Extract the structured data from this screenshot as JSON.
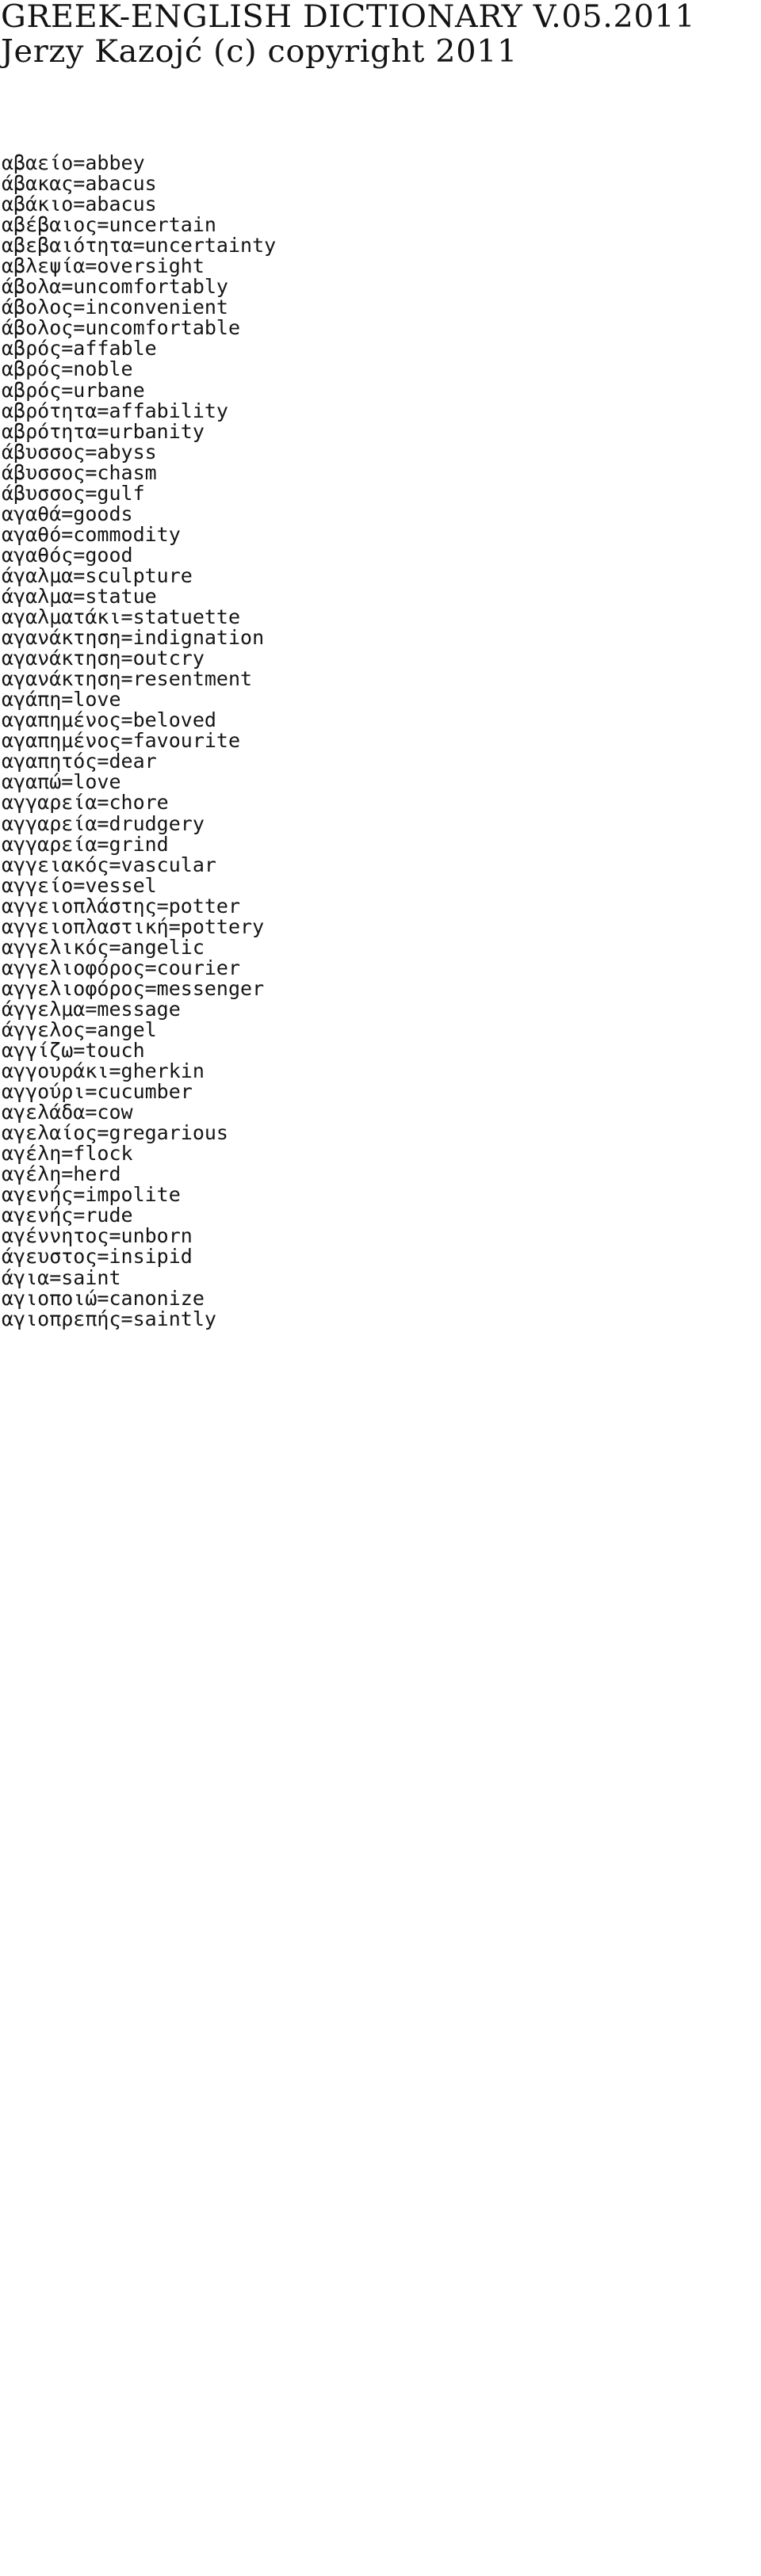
{
  "document": {
    "kind": "text-document",
    "background_color": "#ffffff",
    "text_color": "#151515",
    "header": {
      "title": "GREEK-ENGLISH DICTIONARY V.05.2011",
      "byline": "Jerzy Kazojć (c) copyright 2011"
    },
    "separator": "=",
    "entries": [
      {
        "greek": "αβαείο",
        "english": "abbey",
        "line": "αβαείο=abbey"
      },
      {
        "greek": "άβακας",
        "english": "abacus",
        "line": "άβακας=abacus"
      },
      {
        "greek": "αβάκιο",
        "english": "abacus",
        "line": "αβάκιο=abacus"
      },
      {
        "greek": "αβέβαιος",
        "english": "uncertain",
        "line": "αβέβαιος=uncertain"
      },
      {
        "greek": "αβεβαιότητα",
        "english": "uncertainty",
        "line": "αβεβαιότητα=uncertainty"
      },
      {
        "greek": "αβλεψία",
        "english": "oversight",
        "line": "αβλεψία=oversight"
      },
      {
        "greek": "άβολα",
        "english": "uncomfortably",
        "line": "άβολα=uncomfortably"
      },
      {
        "greek": "άβολος",
        "english": "inconvenient",
        "line": "άβολος=inconvenient"
      },
      {
        "greek": "άβολος",
        "english": "uncomfortable",
        "line": "άβολος=uncomfortable"
      },
      {
        "greek": "αβρός",
        "english": "affable",
        "line": "αβρός=affable"
      },
      {
        "greek": "αβρός",
        "english": "noble",
        "line": "αβρός=noble"
      },
      {
        "greek": "αβρός",
        "english": "urbane",
        "line": "αβρός=urbane"
      },
      {
        "greek": "αβρότητα",
        "english": "affability",
        "line": "αβρότητα=affability"
      },
      {
        "greek": "αβρότητα",
        "english": "urbanity",
        "line": "αβρότητα=urbanity"
      },
      {
        "greek": "άβυσσος",
        "english": "abyss",
        "line": "άβυσσος=abyss"
      },
      {
        "greek": "άβυσσος",
        "english": "chasm",
        "line": "άβυσσος=chasm"
      },
      {
        "greek": "άβυσσος",
        "english": "gulf",
        "line": "άβυσσος=gulf"
      },
      {
        "greek": "αγαθά",
        "english": "goods",
        "line": "αγαθά=goods"
      },
      {
        "greek": "αγαθό",
        "english": "commodity",
        "line": "αγαθό=commodity"
      },
      {
        "greek": "αγαθός",
        "english": "good",
        "line": "αγαθός=good"
      },
      {
        "greek": "άγαλμα",
        "english": "sculpture",
        "line": "άγαλμα=sculpture"
      },
      {
        "greek": "άγαλμα",
        "english": "statue",
        "line": "άγαλμα=statue"
      },
      {
        "greek": "αγαλματάκι",
        "english": "statuette",
        "line": "αγαλματάκι=statuette"
      },
      {
        "greek": "αγανάκτηση",
        "english": "indignation",
        "line": "αγανάκτηση=indignation"
      },
      {
        "greek": "αγανάκτηση",
        "english": "outcry",
        "line": "αγανάκτηση=outcry"
      },
      {
        "greek": "αγανάκτηση",
        "english": "resentment",
        "line": "αγανάκτηση=resentment"
      },
      {
        "greek": "αγάπη",
        "english": "love",
        "line": "αγάπη=love"
      },
      {
        "greek": "αγαπημένος",
        "english": "beloved",
        "line": "αγαπημένος=beloved"
      },
      {
        "greek": "αγαπημένος",
        "english": "favourite",
        "line": "αγαπημένος=favourite"
      },
      {
        "greek": "αγαπητός",
        "english": "dear",
        "line": "αγαπητός=dear"
      },
      {
        "greek": "αγαπώ",
        "english": "love",
        "line": "αγαπώ=love"
      },
      {
        "greek": "αγγαρεία",
        "english": "chore",
        "line": "αγγαρεία=chore"
      },
      {
        "greek": "αγγαρεία",
        "english": "drudgery",
        "line": "αγγαρεία=drudgery"
      },
      {
        "greek": "αγγαρεία",
        "english": "grind",
        "line": "αγγαρεία=grind"
      },
      {
        "greek": "αγγειακός",
        "english": "vascular",
        "line": "αγγειακός=vascular"
      },
      {
        "greek": "αγγείο",
        "english": "vessel",
        "line": "αγγείο=vessel"
      },
      {
        "greek": "αγγειοπλάστης",
        "english": "potter",
        "line": "αγγειοπλάστης=potter"
      },
      {
        "greek": "αγγειοπλαστική",
        "english": "pottery",
        "line": "αγγειοπλαστική=pottery"
      },
      {
        "greek": "αγγελικός",
        "english": "angelic",
        "line": "αγγελικός=angelic"
      },
      {
        "greek": "αγγελιοφόρος",
        "english": "courier",
        "line": "αγγελιοφόρος=courier"
      },
      {
        "greek": "αγγελιοφόρος",
        "english": "messenger",
        "line": "αγγελιοφόρος=messenger"
      },
      {
        "greek": "άγγελμα",
        "english": "message",
        "line": "άγγελμα=message"
      },
      {
        "greek": "άγγελος",
        "english": "angel",
        "line": "άγγελος=angel"
      },
      {
        "greek": "αγγίζω",
        "english": "touch",
        "line": "αγγίζω=touch"
      },
      {
        "greek": "αγγουράκι",
        "english": "gherkin",
        "line": "αγγουράκι=gherkin"
      },
      {
        "greek": "αγγούρι",
        "english": "cucumber",
        "line": "αγγούρι=cucumber"
      },
      {
        "greek": "αγελάδα",
        "english": "cow",
        "line": "αγελάδα=cow"
      },
      {
        "greek": "αγελαίος",
        "english": "gregarious",
        "line": "αγελαίος=gregarious"
      },
      {
        "greek": "αγέλη",
        "english": "flock",
        "line": "αγέλη=flock"
      },
      {
        "greek": "αγέλη",
        "english": "herd",
        "line": "αγέλη=herd"
      },
      {
        "greek": "αγενής",
        "english": "impolite",
        "line": "αγενής=impolite"
      },
      {
        "greek": "αγενής",
        "english": "rude",
        "line": "αγενής=rude"
      },
      {
        "greek": "αγέννητος",
        "english": "unborn",
        "line": "αγέννητος=unborn"
      },
      {
        "greek": "άγευστος",
        "english": "insipid",
        "line": "άγευστος=insipid"
      },
      {
        "greek": "άγια",
        "english": "saint",
        "line": "άγια=saint"
      },
      {
        "greek": "αγιοποιώ",
        "english": "canonize",
        "line": "αγιοποιώ=canonize"
      },
      {
        "greek": "αγιοπρεπής",
        "english": "saintly",
        "line": "αγιοπρεπής=saintly"
      }
    ]
  }
}
